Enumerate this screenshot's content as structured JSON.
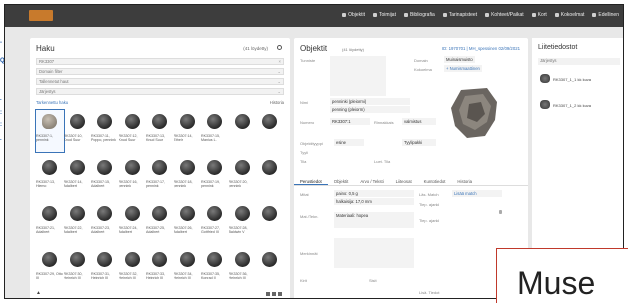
{
  "nav": [
    {
      "label": "Objektit",
      "icon": "image-icon"
    },
    {
      "label": "Toimijat",
      "icon": "person-icon"
    },
    {
      "label": "Bibliografia",
      "icon": "book-icon"
    },
    {
      "label": "Tarinapisteet",
      "icon": "flag-icon"
    },
    {
      "label": "Kohteet/Paikat",
      "icon": "pin-icon"
    },
    {
      "label": "Kort",
      "icon": "card-icon"
    },
    {
      "label": "Kokoelmat",
      "icon": "collection-icon"
    },
    {
      "label": "Edellinen",
      "icon": "circle-icon"
    }
  ],
  "haku": {
    "title": "Haku",
    "count": "(41 löydetty)",
    "fields": [
      {
        "value": "RK3307",
        "placeholder": ""
      },
      {
        "value": "",
        "placeholder": "Domain filter"
      },
      {
        "value": "",
        "placeholder": "Tallennetut haut"
      },
      {
        "value": "",
        "placeholder": "Järjestys"
      }
    ],
    "advanced": "Tarkennettu haku",
    "history": "Historia",
    "footer": "▲",
    "items": [
      {
        "caption": "RK3307:1, pennink",
        "light": true
      },
      {
        "caption": "RK3307:10, Knud Suur",
        "light": false
      },
      {
        "caption": "RK3307:11, Poppo, pennink",
        "light": false
      },
      {
        "caption": "RK3307:12, Knud Suur",
        "light": false
      },
      {
        "caption": "RK3307:13, Knud Suur",
        "light": false
      },
      {
        "caption": "RK3307:14, Ethelr",
        "light": false
      },
      {
        "caption": "RK3307:15, Manius L.",
        "light": false
      },
      {
        "caption": "",
        "light": false
      },
      {
        "caption": "",
        "light": false
      },
      {
        "caption": "RK3307:13, Hiemo",
        "light": false
      },
      {
        "caption": "RK3307:14, Adalbert",
        "light": false
      },
      {
        "caption": "RK3307:15, Adalbert",
        "light": false
      },
      {
        "caption": "RK3307:16, pennink",
        "light": false
      },
      {
        "caption": "RK3307:17, pennink",
        "light": false
      },
      {
        "caption": "RK3307:18, pennink",
        "light": false
      },
      {
        "caption": "RK3307:19, pennink",
        "light": false
      },
      {
        "caption": "RK3307:20, pennink",
        "light": false
      },
      {
        "caption": "",
        "light": false
      },
      {
        "caption": "RK3307:21, Adalbert",
        "light": false
      },
      {
        "caption": "RK3307:22, Adalbert",
        "light": false
      },
      {
        "caption": "RK3307:23, Adalbert",
        "light": false
      },
      {
        "caption": "RK3307:24, Adalbert",
        "light": false
      },
      {
        "caption": "RK3307:25, Adalbert",
        "light": false
      },
      {
        "caption": "RK3307:26, Adalbert",
        "light": false
      },
      {
        "caption": "RK3307:27, Gottfried III",
        "light": false
      },
      {
        "caption": "RK3307:28, Baldwin V",
        "light": false
      },
      {
        "caption": "",
        "light": false
      },
      {
        "caption": "RK3307:29, Otto III",
        "light": false
      },
      {
        "caption": "RK3307:30, Heinrich III",
        "light": false
      },
      {
        "caption": "RK3307:31, Heinrich III",
        "light": false
      },
      {
        "caption": "RK3307:32, Heinrich III",
        "light": false
      },
      {
        "caption": "RK3307:33, Heinrich III",
        "light": false
      },
      {
        "caption": "RK3307:34, Heinrich III",
        "light": false
      },
      {
        "caption": "RK3307:35, Konrad II",
        "light": false
      },
      {
        "caption": "RK3307:36, Heinrich III",
        "light": false
      },
      {
        "caption": "",
        "light": false
      }
    ]
  },
  "objektit": {
    "title": "Objektit",
    "sub": "(41 löydetty)",
    "id_line": "ID: 1970701 | MH_spessinen 02/09/2021",
    "labels": {
      "tunniste": "Tunniste",
      "domain": "Domain",
      "kokoelma": "Kokoelma",
      "nimi": "Nimi",
      "numero": "Numero",
      "objektityyppi": "Objektityyppi",
      "tyyli": "Tyyli",
      "tila": "Tila"
    },
    "values": {
      "domain": "Muinaismuisto",
      "kokoelma": "+ Numismaattinen",
      "nimi1": "penninki (pleiormi)",
      "nimi2": "penning (pleiorm)",
      "numero": "RK3307:1",
      "tyyppi": "esine",
      "rinnakkais": "Rinnakkais",
      "valmistus": "valmistus",
      "pulla": "Tyylipakki",
      "luetila": "Luet. Tila"
    },
    "tabs": [
      "Perustiedot",
      "Objektit",
      "Arvo / Teksti",
      "Liiteosat",
      "Kuntotiedot",
      "Historia"
    ],
    "detail": {
      "paino_label": "Mitat",
      "paino": "paino: 0,5 g",
      "halk": "halkaisija: 17,0 mm",
      "mat_label": "Mat./Tekn.",
      "mat": "Materiaali: hopea",
      "merkinnat": "Merkinnät",
      "side_label1": "Läs. Match",
      "side_val1": "Lisää match",
      "side_label2": "Tiep. ajankl",
      "side_label3": "Tiep. ajankl",
      "bottom_left": "Kirit",
      "bottom_mid": "Sisit",
      "bottom_right": "Lisä. Tiedot"
    }
  },
  "liitteet": {
    "title": "Liitetiedostot",
    "select": "Järjestys",
    "items": [
      "RK3307_1_1 kk kuva",
      "RK3307_1_2 kk kuva"
    ]
  },
  "overlay": {
    "text": "Muse"
  }
}
